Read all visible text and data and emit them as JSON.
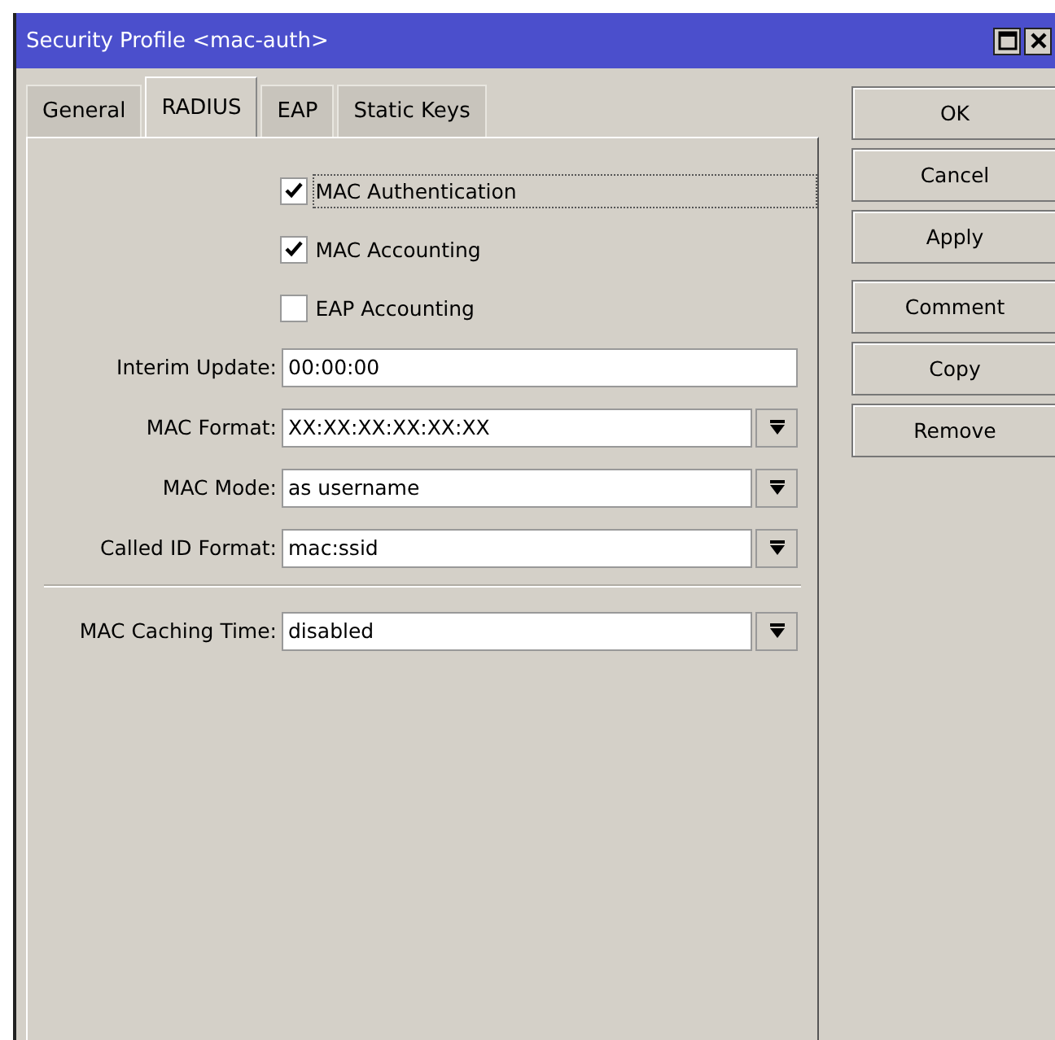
{
  "window": {
    "title": "Security Profile <mac-auth>"
  },
  "tabs": [
    {
      "label": "General",
      "selected": false
    },
    {
      "label": "RADIUS",
      "selected": true
    },
    {
      "label": "EAP",
      "selected": false
    },
    {
      "label": "Static Keys",
      "selected": false
    }
  ],
  "checkboxes": [
    {
      "label": "MAC Authentication",
      "checked": true,
      "focused": true
    },
    {
      "label": "MAC Accounting",
      "checked": true,
      "focused": false
    },
    {
      "label": "EAP Accounting",
      "checked": false,
      "focused": false
    }
  ],
  "fields": [
    {
      "label": "Interim Update:",
      "value": "00:00:00",
      "kind": "text"
    },
    {
      "label": "MAC Format:",
      "value": "XX:XX:XX:XX:XX:XX",
      "kind": "dropdown"
    },
    {
      "label": "MAC Mode:",
      "value": "as username",
      "kind": "dropdown"
    },
    {
      "label": "Called ID Format:",
      "value": "mac:ssid",
      "kind": "dropdown"
    }
  ],
  "caching_field": {
    "label": "MAC Caching Time:",
    "value": "disabled",
    "kind": "dropdown"
  },
  "buttons": [
    [
      "OK",
      "Cancel",
      "Apply"
    ],
    [
      "Comment",
      "Copy",
      "Remove"
    ]
  ]
}
